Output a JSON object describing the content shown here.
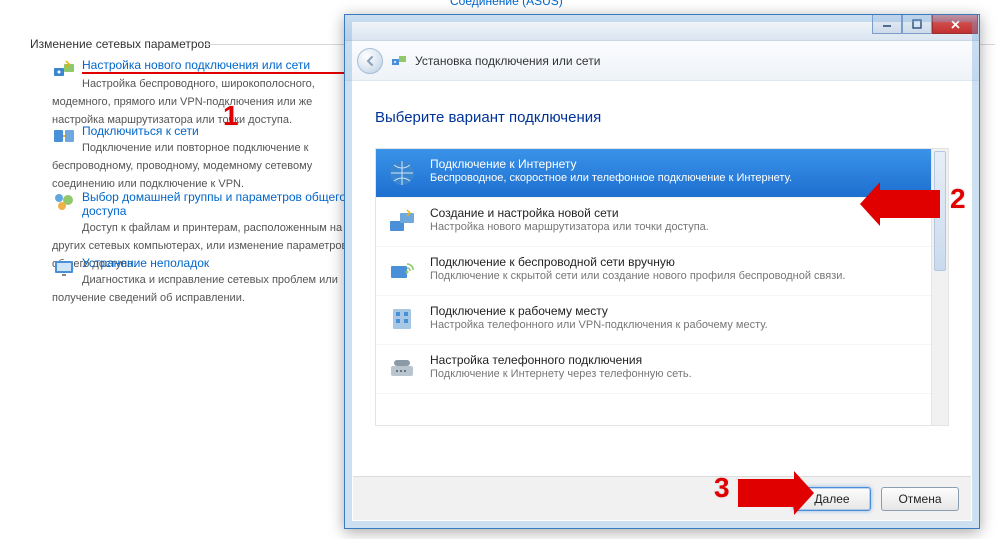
{
  "truncated_link": "Соединение (ASUS)",
  "panel": {
    "heading": "Изменение сетевых параметров",
    "tasks": [
      {
        "title": "Настройка нового подключения или сети",
        "desc": "Настройка беспроводного, широкополосного, модемного, прямого или VPN-подключения или же настройка маршрутизатора или точки доступа."
      },
      {
        "title": "Подключиться к сети",
        "desc": "Подключение или повторное подключение к беспроводному, проводному, модемному сетевому соединению или подключение к VPN."
      },
      {
        "title": "Выбор домашней группы и параметров общего доступа",
        "desc": "Доступ к файлам и принтерам, расположенным на других сетевых компьютерах, или изменение параметров общего доступа."
      },
      {
        "title": "Устранение неполадок",
        "desc": "Диагностика и исправление сетевых проблем или получение сведений об исправлении."
      }
    ]
  },
  "wizard": {
    "window_title": "Установка подключения или сети",
    "heading": "Выберите вариант подключения",
    "options": [
      {
        "title": "Подключение к Интернету",
        "desc": "Беспроводное, скоростное или телефонное подключение к Интернету."
      },
      {
        "title": "Создание и настройка новой сети",
        "desc": "Настройка нового маршрутизатора или точки доступа."
      },
      {
        "title": "Подключение к беспроводной сети вручную",
        "desc": "Подключение к скрытой сети или создание нового профиля беспроводной связи."
      },
      {
        "title": "Подключение к рабочему месту",
        "desc": "Настройка телефонного или VPN-подключения к рабочему месту."
      },
      {
        "title": "Настройка телефонного подключения",
        "desc": "Подключение к Интернету через телефонную сеть."
      }
    ],
    "buttons": {
      "next": "Далее",
      "cancel": "Отмена"
    }
  },
  "annotations": {
    "n1": "1",
    "n2": "2",
    "n3": "3"
  }
}
